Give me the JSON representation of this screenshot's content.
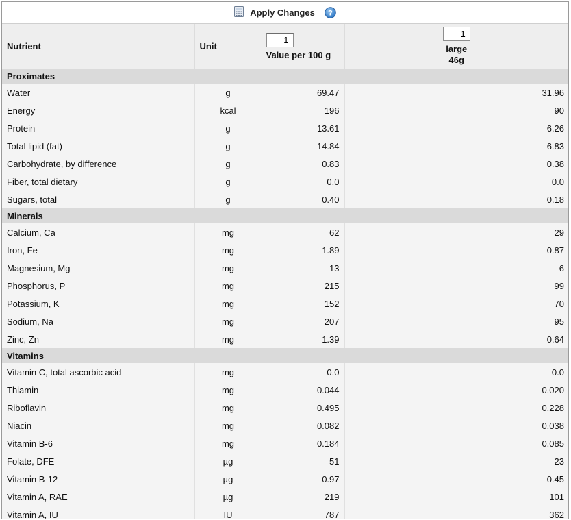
{
  "toolbar": {
    "apply_label": "Apply Changes",
    "apply_icon": "calculator-icon",
    "help_icon": "help-icon"
  },
  "header": {
    "nutrient": "Nutrient",
    "unit": "Unit",
    "value_qty": "1",
    "value_label": "Value per 100 g",
    "serving_qty": "1",
    "serving_label": "large",
    "serving_weight": "46g"
  },
  "groups": [
    {
      "name": "Proximates",
      "rows": [
        [
          "Water",
          "g",
          "69.47",
          "31.96"
        ],
        [
          "Energy",
          "kcal",
          "196",
          "90"
        ],
        [
          "Protein",
          "g",
          "13.61",
          "6.26"
        ],
        [
          "Total lipid (fat)",
          "g",
          "14.84",
          "6.83"
        ],
        [
          "Carbohydrate, by difference",
          "g",
          "0.83",
          "0.38"
        ],
        [
          "Fiber, total dietary",
          "g",
          "0.0",
          "0.0"
        ],
        [
          "Sugars, total",
          "g",
          "0.40",
          "0.18"
        ]
      ]
    },
    {
      "name": "Minerals",
      "rows": [
        [
          "Calcium, Ca",
          "mg",
          "62",
          "29"
        ],
        [
          "Iron, Fe",
          "mg",
          "1.89",
          "0.87"
        ],
        [
          "Magnesium, Mg",
          "mg",
          "13",
          "6"
        ],
        [
          "Phosphorus, P",
          "mg",
          "215",
          "99"
        ],
        [
          "Potassium, K",
          "mg",
          "152",
          "70"
        ],
        [
          "Sodium, Na",
          "mg",
          "207",
          "95"
        ],
        [
          "Zinc, Zn",
          "mg",
          "1.39",
          "0.64"
        ]
      ]
    },
    {
      "name": "Vitamins",
      "rows": [
        [
          "Vitamin C, total ascorbic acid",
          "mg",
          "0.0",
          "0.0"
        ],
        [
          "Thiamin",
          "mg",
          "0.044",
          "0.020"
        ],
        [
          "Riboflavin",
          "mg",
          "0.495",
          "0.228"
        ],
        [
          "Niacin",
          "mg",
          "0.082",
          "0.038"
        ],
        [
          "Vitamin B-6",
          "mg",
          "0.184",
          "0.085"
        ],
        [
          "Folate, DFE",
          "µg",
          "51",
          "23"
        ],
        [
          "Vitamin B-12",
          "µg",
          "0.97",
          "0.45"
        ],
        [
          "Vitamin A, RAE",
          "µg",
          "219",
          "101"
        ],
        [
          "Vitamin A, IU",
          "IU",
          "787",
          "362"
        ]
      ]
    }
  ]
}
